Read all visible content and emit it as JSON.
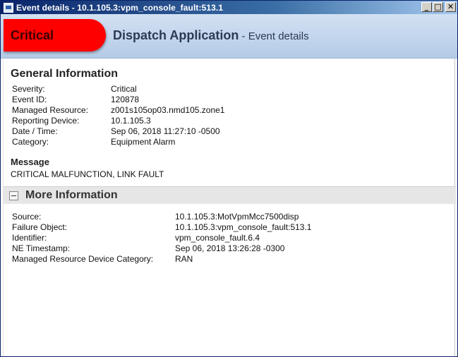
{
  "window": {
    "title": "Event details - 10.1.105.3:vpm_console_fault:513.1",
    "app_icon": "window-app-icon",
    "controls": {
      "minimize": "_",
      "maximize": "□",
      "close": "✕"
    }
  },
  "header": {
    "severity": "Critical",
    "severity_color": "#ff0000",
    "title": "Dispatch Application",
    "subtitle": " - Event details"
  },
  "general": {
    "title": "General Information",
    "rows": [
      {
        "label": "Severity:",
        "value": "Critical"
      },
      {
        "label": "Event ID:",
        "value": "120878"
      },
      {
        "label": "Managed Resource:",
        "value": "z001s105op03.nmd105.zone1"
      },
      {
        "label": "Reporting Device:",
        "value": "10.1.105.3"
      },
      {
        "label": "Date / Time:",
        "value": "Sep 06, 2018 11:27:10 -0500"
      },
      {
        "label": "Category:",
        "value": "Equipment Alarm"
      }
    ]
  },
  "message": {
    "title": "Message",
    "text": "CRITICAL MALFUNCTION, LINK FAULT"
  },
  "more": {
    "title": "More Information",
    "rows": [
      {
        "label": "Source:",
        "value": "10.1.105.3:MotVpmMcc7500disp"
      },
      {
        "label": "Failure Object:",
        "value": "10.1.105.3:vpm_console_fault:513.1"
      },
      {
        "label": "Identifier:",
        "value": "vpm_console_fault.6.4"
      },
      {
        "label": "NE Timestamp:",
        "value": "Sep 06, 2018 13:26:28 -0300"
      },
      {
        "label": "Managed Resource Device Category:",
        "value": "RAN"
      }
    ]
  }
}
